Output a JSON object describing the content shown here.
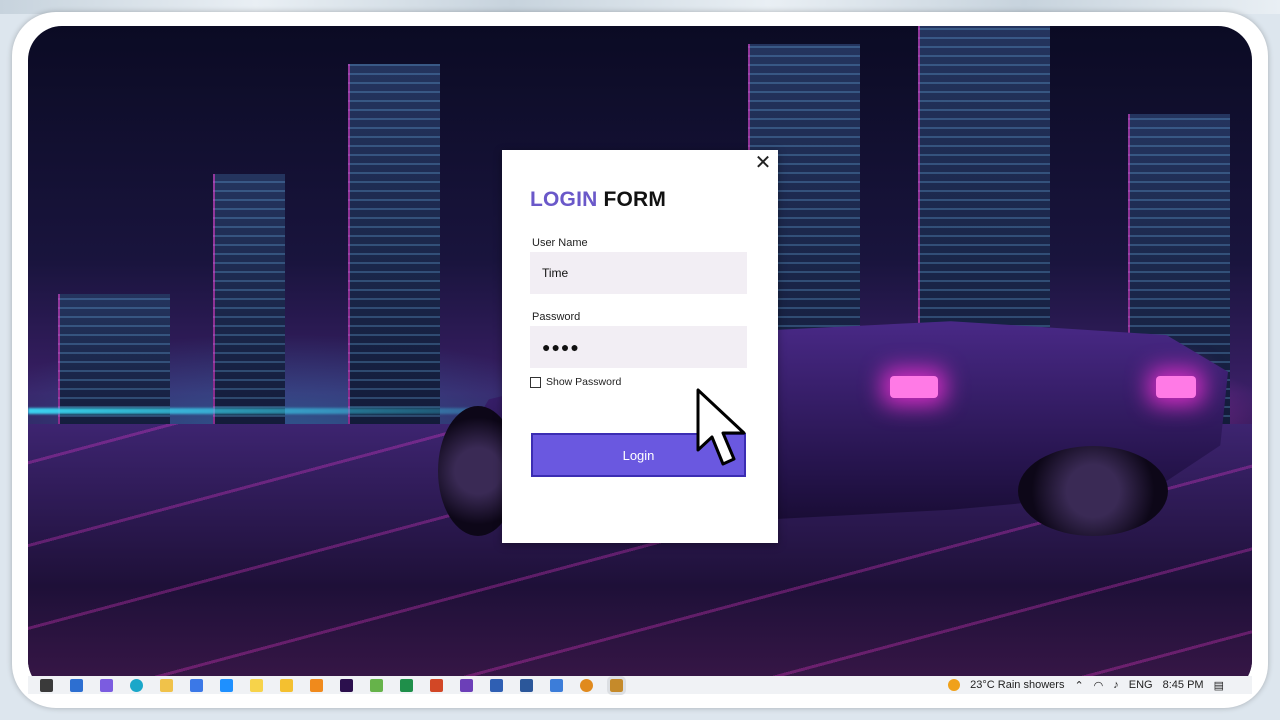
{
  "login_form": {
    "title_part1": "LOGIN",
    "title_part2": "FORM",
    "close_glyph": "✕",
    "username_label": "User Name",
    "username_value": "Time",
    "password_label": "Password",
    "password_value": "●●●●",
    "show_password_label": "Show Password",
    "show_password_checked": false,
    "login_button_label": "Login"
  },
  "taskbar": {
    "weather": "23°C  Rain showers",
    "language": "ENG",
    "time": "8:45 PM",
    "icons": [
      "task-view-icon",
      "file-manager-icon",
      "copilot-icon",
      "edge-icon",
      "folder-icon",
      "store-icon",
      "mail-icon",
      "notes-icon",
      "sticky-notes-icon",
      "vlc-icon",
      "premiere-icon",
      "android-icon",
      "excel-icon",
      "powerpoint-icon",
      "visual-studio-icon",
      "app-icon",
      "word-icon",
      "app2-icon",
      "chrome-like-icon",
      "active-app-icon"
    ]
  },
  "colors": {
    "accent": "#6a58e0",
    "title_accent": "#6a58c9",
    "field_bg": "#f2eef4"
  }
}
